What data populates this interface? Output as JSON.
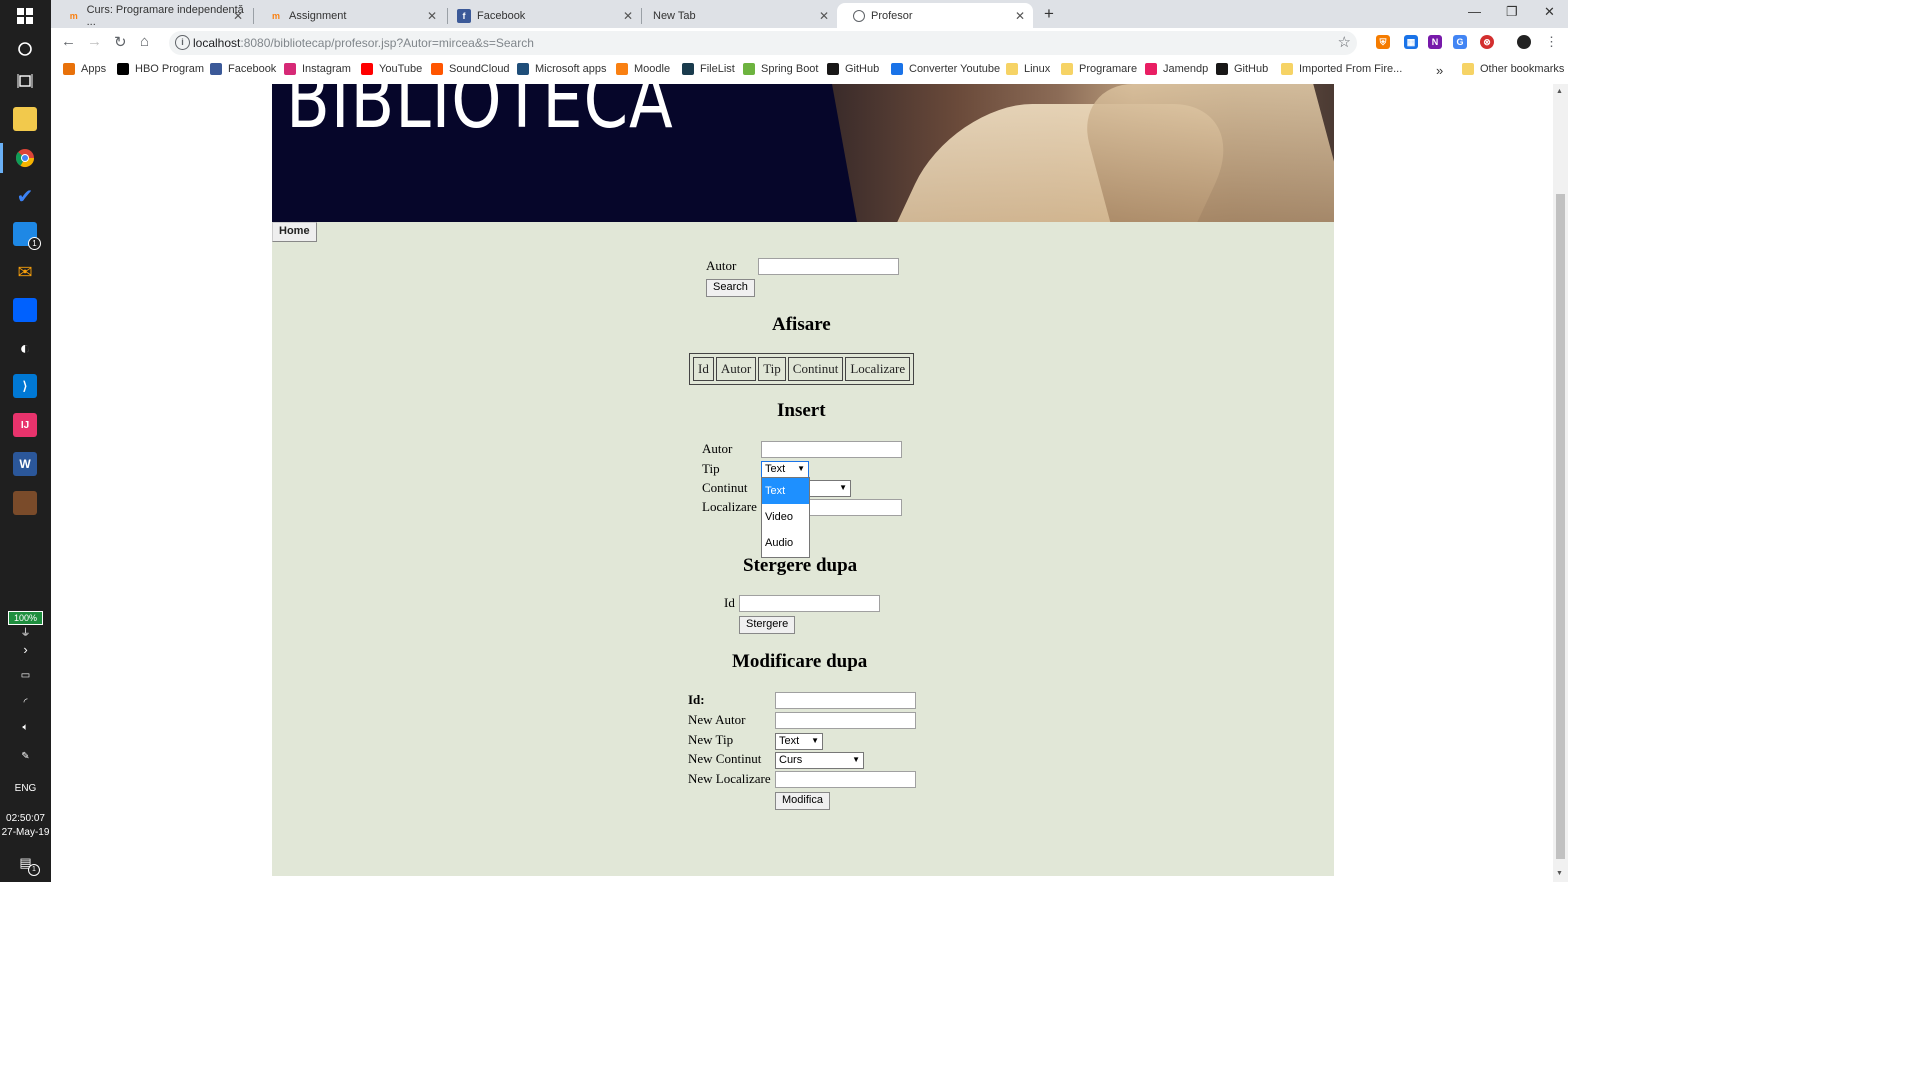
{
  "taskbar": {
    "battery": "100%",
    "time": "02:50:07",
    "date": "27-May-19",
    "language": "ENG",
    "notification_count": "1",
    "messenger_badge": "1"
  },
  "browser": {
    "tabs": [
      {
        "label": "Curs: Programare independentă ...",
        "active": false
      },
      {
        "label": "Assignment",
        "active": false
      },
      {
        "label": "Facebook",
        "active": false
      },
      {
        "label": "New Tab",
        "active": false
      },
      {
        "label": "Profesor",
        "active": true
      }
    ],
    "new_tab_symbol": "+",
    "url_host": "localhost",
    "url_rest": ":8080/bibliotecap/profesor.jsp?Autor=mircea&s=Search",
    "bookmarks": [
      {
        "label": "Apps",
        "icon": "apps-grid-icon",
        "color": "#e8710a"
      },
      {
        "label": "HBO Program",
        "icon": "hbo-icon",
        "color": "#000000"
      },
      {
        "label": "Facebook",
        "icon": "facebook-icon",
        "color": "#3b5998"
      },
      {
        "label": "Instagram",
        "icon": "instagram-icon",
        "color": "#d62976"
      },
      {
        "label": "YouTube",
        "icon": "youtube-icon",
        "color": "#ff0000"
      },
      {
        "label": "SoundCloud",
        "icon": "soundcloud-icon",
        "color": "#ff5500"
      },
      {
        "label": "Microsoft apps",
        "icon": "microsoft-icon",
        "color": "#1f4e79"
      },
      {
        "label": "Moodle",
        "icon": "moodle-icon",
        "color": "#f98012"
      },
      {
        "label": "FileList",
        "icon": "filelist-icon",
        "color": "#1a3b4d"
      },
      {
        "label": "Spring Boot",
        "icon": "spring-icon",
        "color": "#6db33f"
      },
      {
        "label": "GitHub",
        "icon": "github-icon",
        "color": "#181717"
      },
      {
        "label": "Converter Youtube",
        "icon": "converter-icon",
        "color": "#1a73e8"
      },
      {
        "label": "Linux",
        "icon": "folder-icon",
        "color": "#f6d365"
      },
      {
        "label": "Programare",
        "icon": "folder-icon",
        "color": "#f6d365"
      },
      {
        "label": "Jamendp",
        "icon": "jamendo-icon",
        "color": "#e91e63"
      },
      {
        "label": "GitHub",
        "icon": "github-icon",
        "color": "#181717"
      },
      {
        "label": "Imported From Fire...",
        "icon": "folder-icon",
        "color": "#f6d365"
      }
    ],
    "more_bookmarks": "»",
    "other_bookmarks": "Other bookmarks"
  },
  "page": {
    "banner_title": "BIBLIOTECA",
    "home_button": "Home",
    "search": {
      "autor_label": "Autor",
      "autor_value": "",
      "button": "Search"
    },
    "afisare": {
      "heading": "Afisare",
      "columns": [
        "Id",
        "Autor",
        "Tip",
        "Continut",
        "Localizare"
      ]
    },
    "insert": {
      "heading": "Insert",
      "autor_label": "Autor",
      "tip_label": "Tip",
      "tip_value": "Text",
      "continut_label": "Continut",
      "localizare_label": "Localizare",
      "tip_options": [
        "Text",
        "Video",
        "Audio"
      ]
    },
    "stergere": {
      "heading": "Stergere dupa",
      "id_label": "Id",
      "button": "Stergere"
    },
    "modificare": {
      "heading": "Modificare dupa",
      "id_label": "Id:",
      "new_autor_label": "New Autor",
      "new_tip_label": "New Tip",
      "new_tip_value": "Text",
      "new_continut_label": "New Continut",
      "new_continut_value": "Curs",
      "new_localizare_label": "New Localizare",
      "button": "Modifica"
    }
  }
}
